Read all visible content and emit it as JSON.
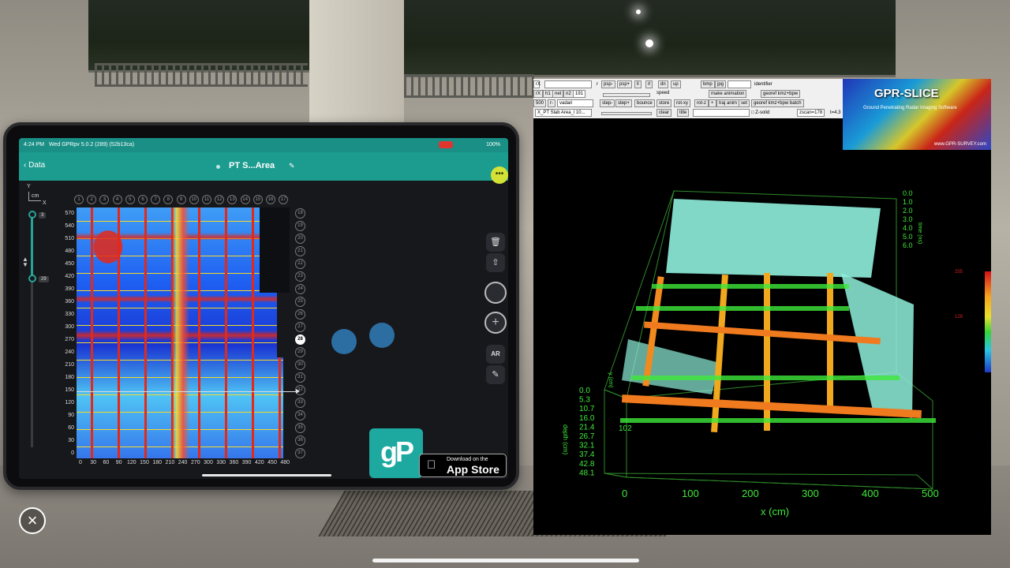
{
  "ipad": {
    "status": {
      "time": "4:24 PM",
      "app": "Wed GPRpv 5.0.2 (289) (52b13ca)",
      "right": "100%"
    },
    "nav": {
      "back_label": "Data",
      "title": "PT S...Area",
      "more_label": "•••"
    },
    "axis": {
      "y_label": "Y",
      "unit": "cm",
      "x_label": "X"
    },
    "depth_slider": {
      "top_value": "3",
      "bottom_value": "29"
    },
    "column_markers": [
      "1",
      "2",
      "3",
      "4",
      "5",
      "6",
      "7",
      "8",
      "9",
      "10",
      "11",
      "12",
      "13",
      "14",
      "15",
      "16",
      "17"
    ],
    "row_markers": [
      "18",
      "19",
      "20",
      "21",
      "22",
      "23",
      "24",
      "25",
      "26",
      "27",
      "28",
      "29",
      "30",
      "31",
      "32",
      "33",
      "34",
      "35",
      "36",
      "37"
    ],
    "active_row": "28",
    "y_ticks": [
      "570",
      "540",
      "510",
      "480",
      "450",
      "420",
      "390",
      "360",
      "330",
      "300",
      "270",
      "240",
      "210",
      "180",
      "150",
      "120",
      "90",
      "60",
      "30",
      "0"
    ],
    "x_ticks": [
      "0",
      "30",
      "60",
      "90",
      "120",
      "150",
      "180",
      "210",
      "240",
      "270",
      "300",
      "330",
      "360",
      "390",
      "420",
      "450",
      "480"
    ],
    "tools": {
      "trash_label": "🗑",
      "share_label": "⇧",
      "add_label": "+",
      "ar_label": "AR",
      "edit_label": "✎"
    }
  },
  "promo": {
    "logo_text": "gP",
    "store_small": "Download on the",
    "store_big": "App Store",
    "apple": ""
  },
  "overlay": {
    "close_label": "×"
  },
  "gpr": {
    "toolbar": {
      "row1": [
        "psp-",
        "psp+",
        "ll",
        "rl",
        "dn",
        "up",
        "bmp",
        "jpg"
      ],
      "identifier_label": "identifier",
      "row2_left": [
        "rX",
        "h1",
        "net",
        "n2",
        "191"
      ],
      "speed_label": "speed",
      "make_animation": "make animation",
      "georef1": "georef kmz+bpw",
      "row3_left": [
        "500",
        "r-",
        "vadari"
      ],
      "row3_mid": [
        "step-",
        "step+",
        "bounce",
        "store",
        "rot-xy",
        "rot-z",
        "+",
        "traj anim",
        "set"
      ],
      "georef2": "georef kmz+bpw batch",
      "row4_file": "X_PT Slab Area_l 10...",
      "clear": "clear",
      "title": "title",
      "zsolid": "Z-solid",
      "zscan": "zscan=178",
      "tval": "t=4.3"
    },
    "logo": {
      "title": "GPR-SLICE",
      "subtitle": "Ground Penetrating Radar Imaging Software",
      "url": "www.GPR-SURVEY.com"
    },
    "plot": {
      "time_ticks": [
        "0.0",
        "1.0",
        "2.0",
        "3.0",
        "4.0",
        "5.0",
        "6.0"
      ],
      "time_label": "time (ns)",
      "depth_ticks": [
        "0.0",
        "5.3",
        "10.7",
        "16.0",
        "21.4",
        "26.7",
        "32.1",
        "37.4",
        "42.8",
        "48.1"
      ],
      "depth_label": "depth (cm)",
      "y_tick": "102",
      "y_axis_label": "y (cm)",
      "x_ticks": [
        "0",
        "100",
        "200",
        "300",
        "400",
        "500"
      ],
      "x_label": "x (cm)",
      "colorbar_top": "255",
      "colorbar_mid": "128"
    }
  }
}
